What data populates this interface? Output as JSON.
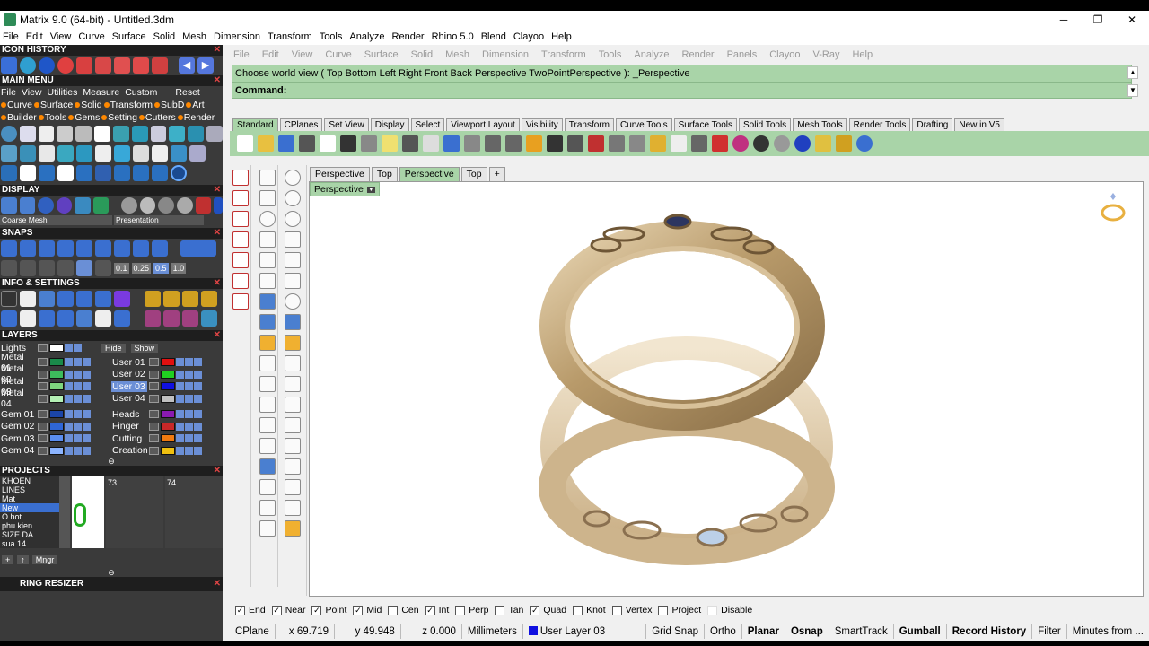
{
  "window": {
    "title": "Matrix 9.0 (64-bit) - Untitled.3dm",
    "minimize": "─",
    "maximize": "❐",
    "close": "✕"
  },
  "menubar": [
    "File",
    "Edit",
    "View",
    "Curve",
    "Surface",
    "Solid",
    "Mesh",
    "Dimension",
    "Transform",
    "Tools",
    "Analyze",
    "Render",
    "Rhino 5.0",
    "Blend",
    "Clayoo",
    "Help"
  ],
  "left": {
    "icon_history": "ICON HISTORY",
    "main_menu": "MAIN MENU",
    "main_menu_row1": [
      "File",
      "View",
      "Utilities",
      "Measure",
      "Custom",
      "Reset"
    ],
    "main_menu_row2": [
      "Curve",
      "Surface",
      "Solid",
      "Transform",
      "SubD",
      "Art"
    ],
    "main_menu_row3": [
      "Builder",
      "Tools",
      "Gems",
      "Setting",
      "Cutters",
      "Render"
    ],
    "display": "DISPLAY",
    "display_mesh": "Coarse Mesh",
    "display_mode": "Presentation",
    "snaps": "SNAPS",
    "snap_values": [
      "0.1",
      "0.25",
      "0.5",
      "1.0"
    ],
    "info": "INFO & SETTINGS",
    "layers": "LAYERS",
    "lights": "Lights",
    "hide": "Hide",
    "show": "Show",
    "layers_left": [
      {
        "name": "Metal 01",
        "color": "#1a8a4a"
      },
      {
        "name": "Metal 02",
        "color": "#3dbb5c"
      },
      {
        "name": "Metal 03",
        "color": "#7fd67f"
      },
      {
        "name": "Metal 04",
        "color": "#b4f0b4"
      },
      {
        "name": "Gem 01",
        "color": "#1b45a8"
      },
      {
        "name": "Gem 02",
        "color": "#2f66d6"
      },
      {
        "name": "Gem 03",
        "color": "#5b8ef0"
      },
      {
        "name": "Gem 04",
        "color": "#8cb4ff"
      }
    ],
    "layers_right": [
      {
        "name": "User 01",
        "color": "#e01010"
      },
      {
        "name": "User 02",
        "color": "#20d020"
      },
      {
        "name": "User 03",
        "color": "#1010e0",
        "selected": true
      },
      {
        "name": "User 04",
        "color": "#c0c0c0"
      },
      {
        "name": "Heads",
        "color": "#8a1ab0"
      },
      {
        "name": "Finger",
        "color": "#c82828"
      },
      {
        "name": "Cutting",
        "color": "#f07a10"
      },
      {
        "name": "Creation",
        "color": "#f0c010"
      }
    ],
    "projects": "PROJECTS",
    "project_list": [
      "KHOEN",
      "LINES",
      "Mat",
      "New",
      "O hot",
      "phu kien",
      "SIZE DA",
      "sua 14"
    ],
    "project_selected": "New",
    "thumbs": [
      "73",
      "74"
    ],
    "mngr": "Mngr",
    "ring_resizer": "RING RESIZER"
  },
  "cmd": {
    "menu": [
      "File",
      "Edit",
      "View",
      "Curve",
      "Surface",
      "Solid",
      "Mesh",
      "Dimension",
      "Transform",
      "Tools",
      "Analyze",
      "Render",
      "Panels",
      "Clayoo",
      "V-Ray",
      "Help"
    ],
    "history": "Choose world view ( Top  Bottom  Left  Right  Front  Back  Perspective  TwoPointPerspective ): _Perspective",
    "command": "Command:"
  },
  "toolbar_tabs": [
    "Standard",
    "CPlanes",
    "Set View",
    "Display",
    "Select",
    "Viewport Layout",
    "Visibility",
    "Transform",
    "Curve Tools",
    "Surface Tools",
    "Solid Tools",
    "Mesh Tools",
    "Render Tools",
    "Drafting",
    "New in V5"
  ],
  "viewport_tabs": [
    "Perspective",
    "Top",
    "Perspective",
    "Top",
    "+"
  ],
  "viewport_label": "Perspective",
  "osnaps": [
    {
      "label": "End",
      "checked": true
    },
    {
      "label": "Near",
      "checked": true
    },
    {
      "label": "Point",
      "checked": true
    },
    {
      "label": "Mid",
      "checked": true
    },
    {
      "label": "Cen",
      "checked": false
    },
    {
      "label": "Int",
      "checked": true
    },
    {
      "label": "Perp",
      "checked": false
    },
    {
      "label": "Tan",
      "checked": false
    },
    {
      "label": "Quad",
      "checked": true
    },
    {
      "label": "Knot",
      "checked": false
    },
    {
      "label": "Vertex",
      "checked": false
    },
    {
      "label": "Project",
      "checked": false
    },
    {
      "label": "Disable",
      "checked": false
    }
  ],
  "status": {
    "cplane": "CPlane",
    "x": "x 69.719",
    "y": "y 49.948",
    "z": "z 0.000",
    "units": "Millimeters",
    "layer": "User Layer 03",
    "grid_snap": "Grid Snap",
    "ortho": "Ortho",
    "planar": "Planar",
    "osnap": "Osnap",
    "smarttrack": "SmartTrack",
    "gumball": "Gumball",
    "record_history": "Record History",
    "filter": "Filter",
    "minutes": "Minutes from ..."
  }
}
